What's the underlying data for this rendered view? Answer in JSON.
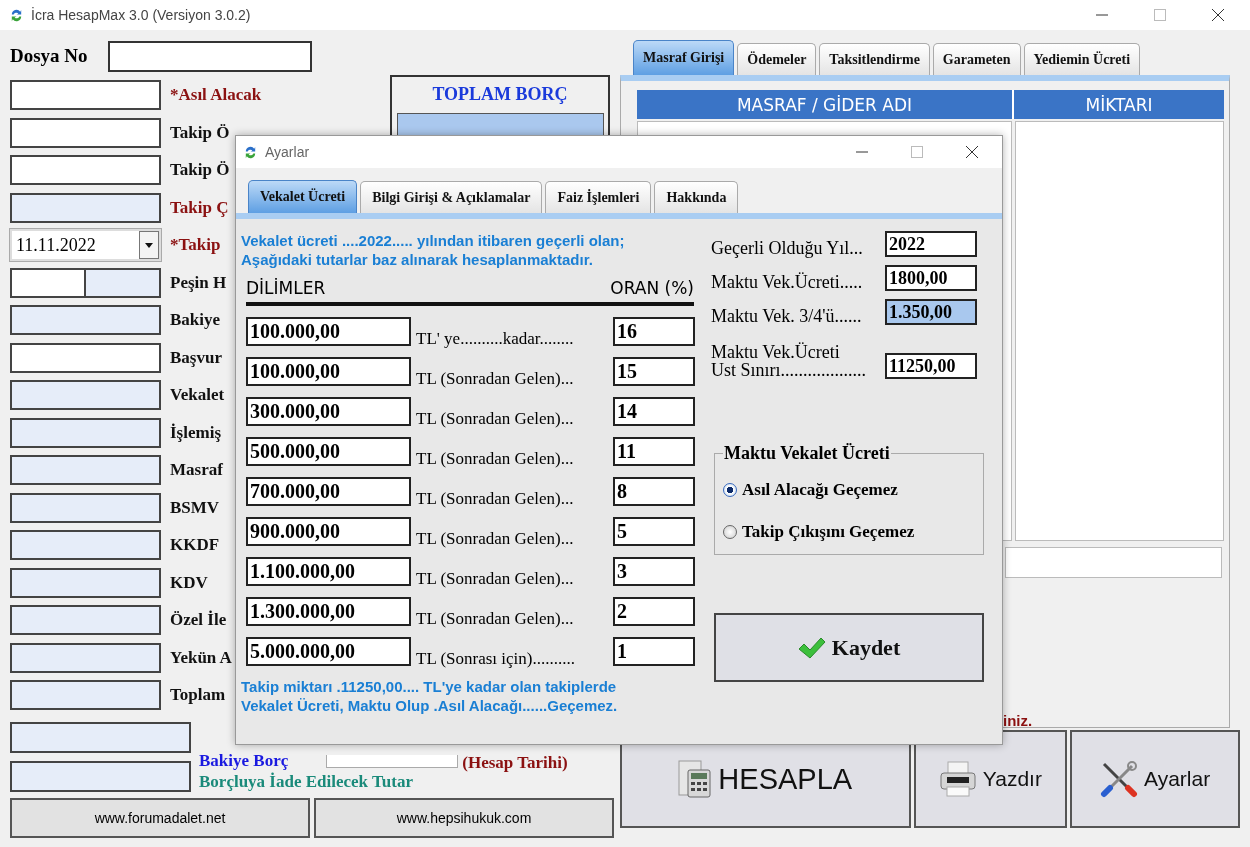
{
  "window": {
    "title": "İcra HesapMax 3.0 (Versiyon 3.0.2)"
  },
  "file_no": {
    "label": "Dosya No"
  },
  "fields": [
    {
      "kind": "text",
      "readonly": false,
      "label": "*Asıl Alacak",
      "color": "#8b1111"
    },
    {
      "kind": "text",
      "readonly": false,
      "label": "Takip Ö",
      "color": "#111111"
    },
    {
      "kind": "text",
      "readonly": false,
      "label": "Takip Ö",
      "color": "#111111"
    },
    {
      "kind": "text",
      "readonly": true,
      "label": "Takip Ç",
      "color": "#8b1111"
    },
    {
      "kind": "date",
      "value": "11.11.2022",
      "label": "*Takip",
      "color": "#8b1111"
    },
    {
      "kind": "split",
      "label": "Peşin H",
      "color": "#111111"
    },
    {
      "kind": "text",
      "readonly": true,
      "label": "Bakiye",
      "color": "#111111"
    },
    {
      "kind": "text",
      "readonly": false,
      "label": "Başvur",
      "color": "#111111"
    },
    {
      "kind": "text",
      "readonly": true,
      "label": "Vekalet",
      "color": "#111111"
    },
    {
      "kind": "text",
      "readonly": true,
      "label": "İşlemiş",
      "color": "#111111"
    },
    {
      "kind": "text",
      "readonly": true,
      "label": "Masraf",
      "color": "#111111"
    },
    {
      "kind": "text",
      "readonly": true,
      "label": "BSMV",
      "color": "#111111"
    },
    {
      "kind": "text",
      "readonly": true,
      "label": "KKDF",
      "color": "#111111"
    },
    {
      "kind": "text",
      "readonly": true,
      "label": "KDV",
      "color": "#111111"
    },
    {
      "kind": "text",
      "readonly": true,
      "label": "Özel İle",
      "color": "#111111"
    },
    {
      "kind": "text",
      "readonly": true,
      "label": "Yekün A",
      "color": "#111111"
    },
    {
      "kind": "text",
      "readonly": true,
      "label": "Toplam",
      "color": "#111111"
    }
  ],
  "totals": [
    {
      "label": "Bakiye Borç",
      "color": "#1a1ae0",
      "date_label": "(Hesap Tarihi)"
    },
    {
      "label": "Borçluya İade Edilecek Tutar",
      "color": "#1a8a7a"
    }
  ],
  "links": [
    "www.forumadalet.net",
    "www.hepsihukuk.com"
  ],
  "total_debt": {
    "title": "TOPLAM BORÇ"
  },
  "right_tabs": [
    {
      "label": "Masraf Girişi",
      "selected": true
    },
    {
      "label": "Ödemeler",
      "selected": false
    },
    {
      "label": "Taksitlendirme",
      "selected": false
    },
    {
      "label": "Garameten",
      "selected": false
    },
    {
      "label": "Yediemin Ücreti",
      "selected": false
    }
  ],
  "expense_table": {
    "columns": [
      "MASRAF / GİDER ADI",
      "MİKTARI"
    ]
  },
  "note": "iniz.",
  "actions": [
    {
      "kind": "calculate",
      "label": "HESAPLA"
    },
    {
      "kind": "print",
      "label": "Yazdır"
    },
    {
      "kind": "settings",
      "label": "Ayarlar"
    }
  ],
  "dialog": {
    "title": "Ayarlar",
    "tabs": [
      {
        "label": "Vekalet Ücreti",
        "selected": true
      },
      {
        "label": "Bilgi Girişi & Açıklamalar",
        "selected": false
      },
      {
        "label": "Faiz İşlemleri",
        "selected": false
      },
      {
        "label": "Hakkında",
        "selected": false
      }
    ],
    "intro": [
      "Vekalet ücreti ....2022..... yılından itibaren geçerli olan;",
      "Aşağıdaki tutarlar baz alınarak hesaplanmaktadır."
    ],
    "headers": [
      "DİLİMLER",
      "ORAN (%)"
    ],
    "brackets": [
      {
        "amount": "100.000,00",
        "text": "TL' ye..........kadar........",
        "rate": "16"
      },
      {
        "amount": "100.000,00",
        "text": "TL (Sonradan Gelen)...",
        "rate": "15"
      },
      {
        "amount": "300.000,00",
        "text": "TL (Sonradan Gelen)...",
        "rate": "14"
      },
      {
        "amount": "500.000,00",
        "text": "TL (Sonradan Gelen)...",
        "rate": "11"
      },
      {
        "amount": "700.000,00",
        "text": "TL (Sonradan Gelen)...",
        "rate": "8"
      },
      {
        "amount": "900.000,00",
        "text": "TL (Sonradan Gelen)...",
        "rate": "5"
      },
      {
        "amount": "1.100.000,00",
        "text": "TL (Sonradan Gelen)...",
        "rate": "3"
      },
      {
        "amount": "1.300.000,00",
        "text": "TL (Sonradan Gelen)...",
        "rate": "2"
      },
      {
        "amount": "5.000.000,00",
        "text": "TL (Sonrası için)..........",
        "rate": "1"
      }
    ],
    "footer": [
      "Takip miktarı .11250,00.... TL'ye kadar olan takiplerde",
      "Vekalet Ücreti, Maktu Olup .Asıl Alacağı......Geçemez."
    ],
    "settings": [
      {
        "label": "Geçerli Olduğu Yıl...",
        "value": "2022",
        "highlighted": false
      },
      {
        "label": "Maktu Vek.Ücreti.....",
        "value": "1800,00",
        "highlighted": false
      },
      {
        "label": "Maktu Vek. 3/4'ü......",
        "value": "1.350,00",
        "highlighted": true
      },
      {
        "label": "Maktu Vek.Ücreti\nUst Sınırı...................",
        "value": "11250,00",
        "highlighted": false
      }
    ],
    "limit_group": {
      "title": "Maktu Vekalet Ücreti",
      "options": [
        {
          "label": "Asıl Alacağı Geçemez",
          "selected": true
        },
        {
          "label": "Takip Çıkışını Geçemez",
          "selected": false
        }
      ]
    },
    "save": "Kaydet"
  }
}
